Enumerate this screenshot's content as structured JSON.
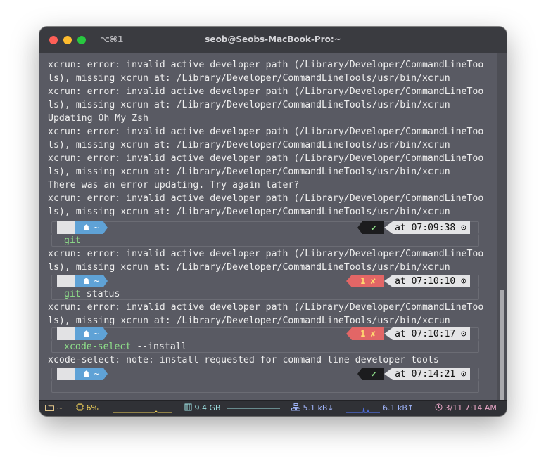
{
  "titlebar": {
    "shortcut": "⌥⌘1",
    "title": "seob@Seobs-MacBook-Pro:~"
  },
  "terminal": {
    "err_line1": "xcrun: error: invalid active developer path (/Library/Developer/CommandLineToo",
    "err_line2": "ls), missing xcrun at: /Library/Developer/CommandLineTools/usr/bin/xcrun",
    "updating": "Updating Oh My Zsh",
    "update_error": "There was an error updating. Try again later?",
    "note": "xcode-select: note: install requested for command line developer tools"
  },
  "prompts": [
    {
      "command": "git",
      "args": "",
      "status": "✔",
      "time": "at 07:09:38"
    },
    {
      "command": "git",
      "args": " status",
      "status": "1 ✘",
      "time": "at 07:10:10"
    },
    {
      "command": "xcode-select",
      "args": " --install",
      "status": "1 ✘",
      "time": "at 07:10:17"
    },
    {
      "command": "",
      "args": "",
      "status": "✔",
      "time": "at 07:14:21"
    }
  ],
  "prompt_glyphs": {
    "apple": "",
    "home": "☗ ~",
    "clock": "⊙"
  },
  "statusbar": {
    "dir": "~",
    "cpu": "6%",
    "mem": "9.4 GB",
    "down": "5.1 kB↓",
    "up": "6.1 kB↑",
    "datetime": "3/11 7:14 AM"
  },
  "colors": {
    "background": "#595a63",
    "prompt_green": "#8fe08a",
    "home_segment": "#5fa2d6",
    "error_segment": "#e26666"
  }
}
